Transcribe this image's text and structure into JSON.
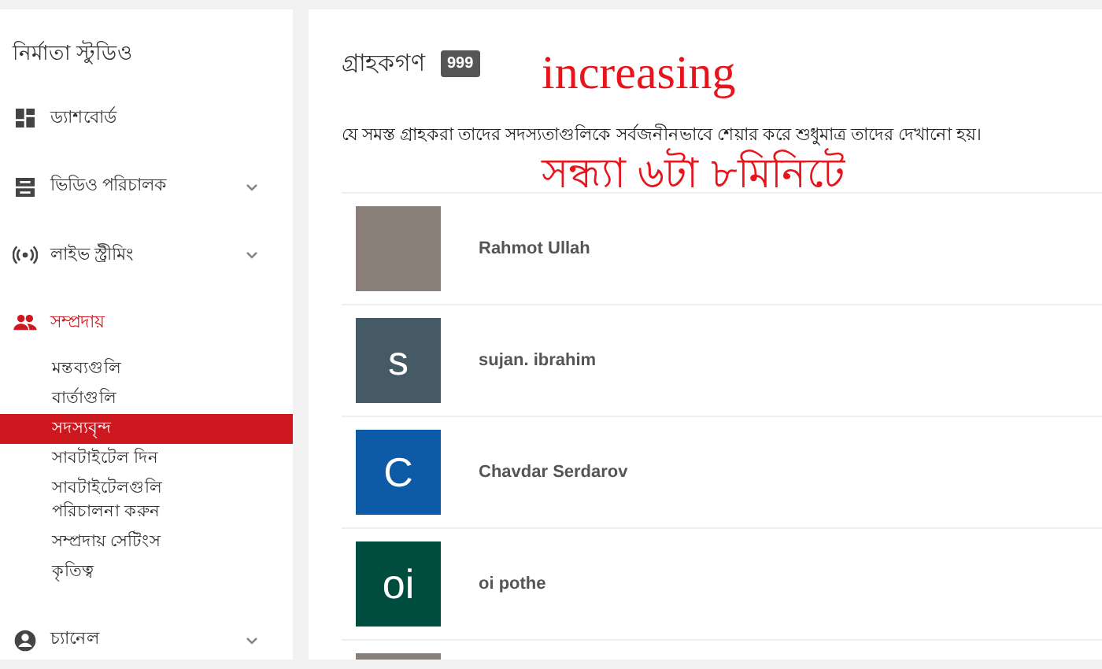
{
  "sidebar": {
    "title": "নির্মাতা স্টুডিও",
    "nav": [
      {
        "label": "ড্যাশবোর্ড",
        "kind": "link",
        "selected": false
      },
      {
        "label": "ভিডিও পরিচালক",
        "kind": "group",
        "selected": false
      },
      {
        "label": "লাইভ স্ট্রীমিং",
        "kind": "group",
        "selected": false
      },
      {
        "label": "সম্প্রদায়",
        "kind": "link",
        "selected": true
      }
    ],
    "subitems": [
      {
        "label": "মন্তব্যগুলি",
        "selected": false
      },
      {
        "label": "বার্তাগুলি",
        "selected": false
      },
      {
        "label": "সদস্যবৃন্দ",
        "selected": true
      },
      {
        "label": "সাবটাইটেল দিন",
        "selected": false
      },
      {
        "label": "সাবটাইটেলগুলি পরিচালনা করুন",
        "selected": false
      },
      {
        "label": "সম্প্রদায় সেটিংস",
        "selected": false
      },
      {
        "label": "কৃতিত্ব",
        "selected": false
      }
    ],
    "footer_item": {
      "label": "চ্যানেল",
      "kind": "group",
      "selected": false
    }
  },
  "main": {
    "title": "গ্রাহকগণ",
    "count": "999",
    "description": "যে সমস্ত গ্রাহকরা তাদের সদস্যতাগুলিকে সর্বজনীনভাবে শেয়ার করে শুধুমাত্র তাদের দেখানো হয়।",
    "subscribers": [
      {
        "kind": "photo",
        "name": "Rahmot Ullah"
      },
      {
        "kind": "letter",
        "initial": "s",
        "color": "#455a64",
        "name": "sujan. ibrahim"
      },
      {
        "kind": "letter",
        "initial": "C",
        "color": "#0d5aa7",
        "name": "Chavdar Serdarov"
      },
      {
        "kind": "letter",
        "initial": "oi",
        "color": "#004d40",
        "name": "oi pothe"
      },
      {
        "kind": "photo"
      }
    ]
  },
  "overlay": {
    "line_1": "increasing",
    "line_2": "সন্ধ্যা ৬টা ৮মিনিটে"
  }
}
